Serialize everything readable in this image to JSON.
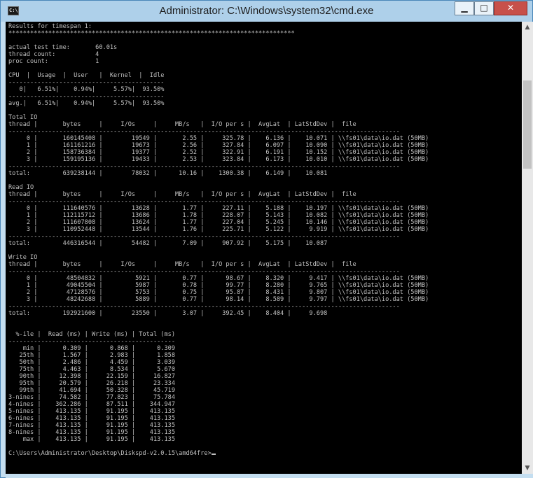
{
  "window": {
    "title": "Administrator: C:\\Windows\\system32\\cmd.exe",
    "icon_text": "C:\\",
    "controls": {
      "minimize": "▁",
      "maximize": "□",
      "close": "✕"
    }
  },
  "console": {
    "lines": [
      "Results for timespan 1:",
      "*******************************************************************************",
      "",
      "actual test time:       60.01s",
      "thread count:           4",
      "proc count:             1",
      "",
      "CPU  |  Usage  |  User   |  Kernel  |  Idle",
      "-------------------------------------------",
      "   0|   6.51%|    0.94%|     5.57%|  93.50%",
      "-------------------------------------------",
      "avg.|   6.51%|    0.94%|     5.57%|  93.50%",
      "",
      "Total IO",
      "thread |       bytes     |     I/Os     |     MB/s   |  I/O per s |  AvgLat  | LatStdDev |  file",
      "------------------------------------------------------------------------------------------------------------",
      "     0 |       160145408 |        19549 |       2.55 |     325.78 |    6.136 |    10.071 | \\\\fs01\\data\\io.dat (50MB)",
      "     1 |       161161216 |        19673 |       2.56 |     327.84 |    6.097 |    10.090 | \\\\fs01\\data\\io.dat (50MB)",
      "     2 |       158736384 |        19377 |       2.52 |     322.91 |    6.191 |    10.152 | \\\\fs01\\data\\io.dat (50MB)",
      "     3 |       159195136 |        19433 |       2.53 |     323.84 |    6.173 |    10.010 | \\\\fs01\\data\\io.dat (50MB)",
      "------------------------------------------------------------------------------------------------------------",
      "total:         639238144 |        78032 |      10.16 |    1300.38 |    6.149 |    10.081",
      "",
      "Read IO",
      "thread |       bytes     |     I/Os     |     MB/s   |  I/O per s |  AvgLat  | LatStdDev |  file",
      "------------------------------------------------------------------------------------------------------------",
      "     0 |       111640576 |        13628 |       1.77 |     227.11 |    5.188 |    10.197 | \\\\fs01\\data\\io.dat (50MB)",
      "     1 |       112115712 |        13686 |       1.78 |     228.07 |    5.143 |    10.082 | \\\\fs01\\data\\io.dat (50MB)",
      "     2 |       111607808 |        13624 |       1.77 |     227.04 |    5.245 |    10.146 | \\\\fs01\\data\\io.dat (50MB)",
      "     3 |       110952448 |        13544 |       1.76 |     225.71 |    5.122 |     9.919 | \\\\fs01\\data\\io.dat (50MB)",
      "------------------------------------------------------------------------------------------------------------",
      "total:         446316544 |        54482 |       7.09 |     907.92 |    5.175 |    10.087",
      "",
      "Write IO",
      "thread |       bytes     |     I/Os     |     MB/s   |  I/O per s |  AvgLat  | LatStdDev |  file",
      "------------------------------------------------------------------------------------------------------------",
      "     0 |        48504832 |         5921 |       0.77 |      98.67 |    8.320 |     9.417 | \\\\fs01\\data\\io.dat (50MB)",
      "     1 |        49045504 |         5987 |       0.78 |      99.77 |    8.280 |     9.765 | \\\\fs01\\data\\io.dat (50MB)",
      "     2 |        47128576 |         5753 |       0.75 |      95.87 |    8.431 |     9.807 | \\\\fs01\\data\\io.dat (50MB)",
      "     3 |        48242688 |         5889 |       0.77 |      98.14 |    8.589 |     9.797 | \\\\fs01\\data\\io.dat (50MB)",
      "------------------------------------------------------------------------------------------------------------",
      "total:         192921600 |        23550 |       3.07 |     392.45 |    8.404 |     9.698",
      "",
      "",
      "  %-ile |  Read (ms) | Write (ms) | Total (ms)",
      "----------------------------------------------",
      "    min |      0.309 |      0.868 |      0.309",
      "   25th |      1.567 |      2.983 |      1.858",
      "   50th |      2.486 |      4.459 |      3.039",
      "   75th |      4.463 |      8.534 |      5.670",
      "   90th |     12.398 |     22.159 |     16.827",
      "   95th |     20.579 |     26.218 |     23.334",
      "   99th |     41.694 |     50.328 |     45.719",
      "3-nines |     74.582 |     77.823 |     75.784",
      "4-nines |    362.286 |     87.511 |    344.947",
      "5-nines |    413.135 |     91.195 |    413.135",
      "6-nines |    413.135 |     91.195 |    413.135",
      "7-nines |    413.135 |     91.195 |    413.135",
      "8-nines |    413.135 |     91.195 |    413.135",
      "    max |    413.135 |     91.195 |    413.135",
      ""
    ],
    "prompt": "C:\\Users\\Administrator\\Desktop\\Diskspd-v2.0.15\\amd64fre>"
  },
  "scrollbar": {
    "up_arrow": "▲",
    "down_arrow": "▼"
  }
}
